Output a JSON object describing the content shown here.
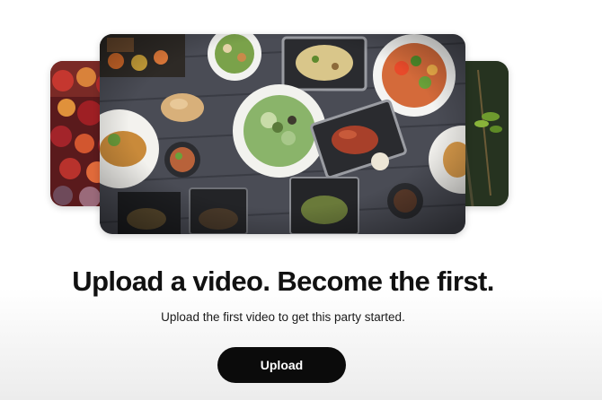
{
  "empty_state": {
    "headline": "Upload a video. Become the first.",
    "subtext": "Upload the first video to get this party started.",
    "upload_button_label": "Upload"
  },
  "carousel": {
    "items": [
      {
        "name": "left-preview",
        "subject": "fruit-image"
      },
      {
        "name": "main-preview",
        "subject": "food-table-image"
      },
      {
        "name": "right-preview",
        "subject": "herbs-image"
      }
    ]
  },
  "colors": {
    "button_background": "#0b0b0b",
    "button_text": "#ffffff",
    "headline": "#111111"
  }
}
